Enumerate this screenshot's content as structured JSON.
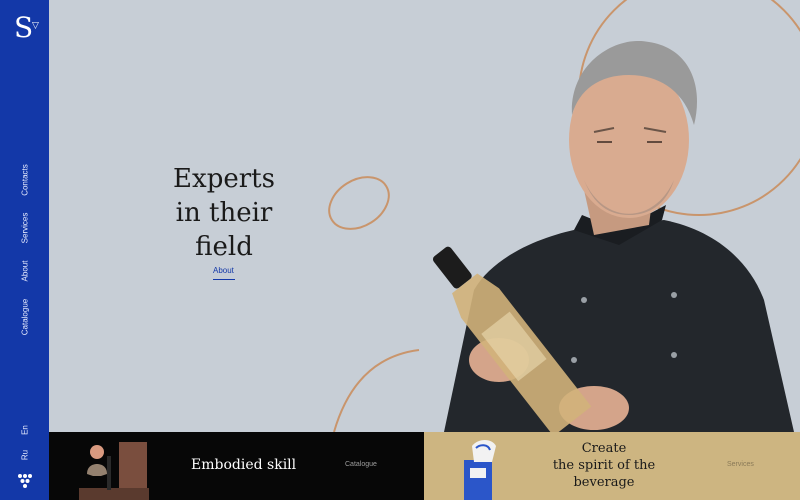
{
  "sidebar": {
    "logo": "S",
    "nav": [
      "Contacts",
      "Services",
      "About",
      "Catalogue"
    ],
    "langs": [
      "En",
      "Ru"
    ],
    "grapes_icon": "grapes-icon"
  },
  "hero": {
    "title_line1": "Experts",
    "title_line2": "in their field",
    "about_link": "About"
  },
  "tiles": {
    "left": {
      "title": "Embodied skill",
      "link": "Catalogue"
    },
    "right": {
      "title_line1": "Create",
      "title_line2": "the spirit of the",
      "title_line3": "beverage",
      "link": "Services"
    }
  },
  "colors": {
    "sidebar": "#1338a8",
    "background": "#c7ced6",
    "tile_dark": "#070707",
    "tile_gold": "#cdb581",
    "accent_ring": "#c9956c"
  }
}
